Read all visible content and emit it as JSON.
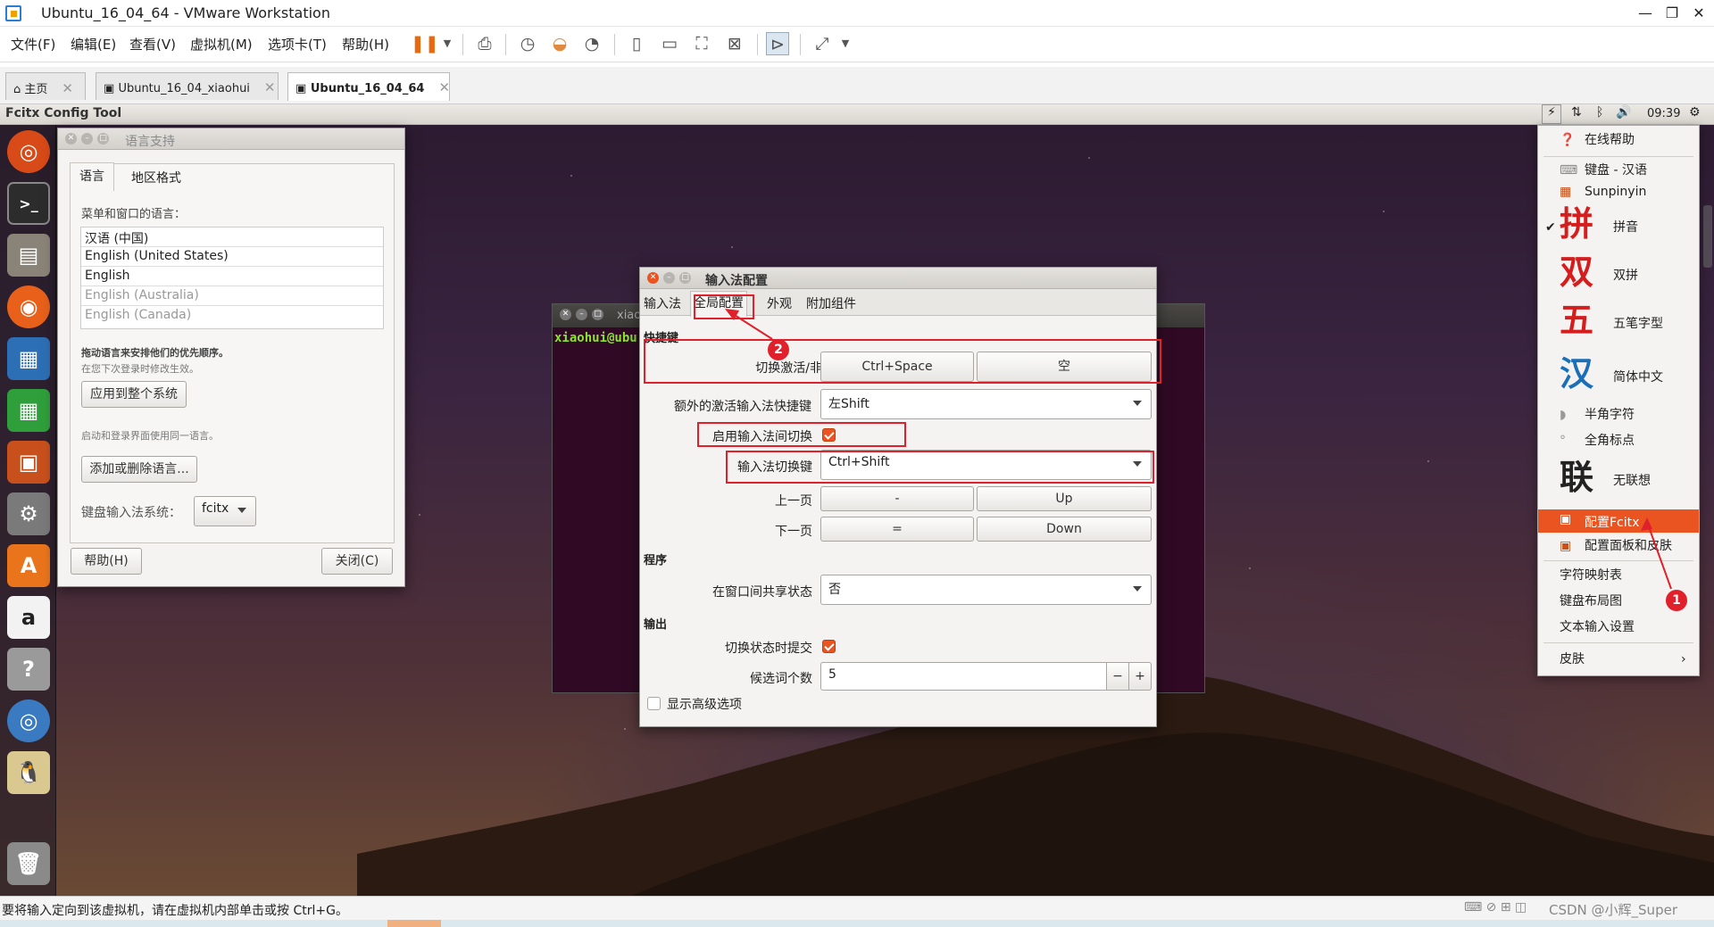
{
  "host": {
    "title": "Ubuntu_16_04_64 - VMware Workstation",
    "menus": [
      "文件(F)",
      "编辑(E)",
      "查看(V)",
      "虚拟机(M)",
      "选项卡(T)",
      "帮助(H)"
    ],
    "tabs": [
      {
        "label": "主页",
        "active": false
      },
      {
        "label": "Ubuntu_16_04_xiaohui",
        "active": false
      },
      {
        "label": "Ubuntu_16_04_64",
        "active": true
      }
    ],
    "status": "要将输入定向到该虚拟机，请在虚拟机内部单击或按 Ctrl+G。",
    "watermark": "CSDN @小辉_Super"
  },
  "ubuntu": {
    "app_title": "Fcitx Config Tool",
    "clock": "09:39"
  },
  "language_window": {
    "title": "语言支持",
    "tabs": [
      "语言",
      "地区格式"
    ],
    "section_label": "菜单和窗口的语言：",
    "languages": [
      "汉语 (中国)",
      "English (United States)",
      "English",
      "English (Australia)",
      "English (Canada)"
    ],
    "hint_bold": "拖动语言来安排他们的优先顺序。",
    "hint_small": "在您下次登录时修改生效。",
    "apply_button": "应用到整个系统",
    "login_hint": "启动和登录界面使用同一语言。",
    "add_remove_button": "添加或删除语言...",
    "im_system_label": "键盘输入法系统：",
    "im_system_value": "fcitx",
    "help_button": "帮助(H)",
    "close_button": "关闭(C)"
  },
  "terminal": {
    "title": "xiao",
    "prompt": "xiaohui@ubu"
  },
  "im_config": {
    "title": "输入法配置",
    "tabs": [
      "输入法",
      "全局配置",
      "外观",
      "附加组件"
    ],
    "active_tab": 1,
    "section_hotkey": "快捷键",
    "toggle_label": "切换激活/非激活输入法",
    "toggle_key1": "Ctrl+Space",
    "toggle_key2": "空",
    "extra_label": "额外的激活输入法快捷键",
    "extra_value": "左Shift",
    "enable_switch_label": "启用输入法间切换",
    "enable_switch_checked": true,
    "switch_key_label": "输入法切换键",
    "switch_key_value": "Ctrl+Shift",
    "prev_label": "上一页",
    "prev_key1": "-",
    "prev_key2": "Up",
    "next_label": "下一页",
    "next_key1": "=",
    "next_key2": "Down",
    "section_program": "程序",
    "share_label": "在窗口间共享状态",
    "share_value": "否",
    "section_output": "输出",
    "commit_label": "切换状态时提交",
    "commit_checked": true,
    "candidates_label": "候选词个数",
    "candidates_value": "5",
    "advanced_label": "显示高级选项",
    "advanced_checked": false
  },
  "annotations": [
    "1",
    "2"
  ],
  "tray_menu": {
    "online_help": "在线帮助",
    "keyboard": "键盘 - 汉语",
    "sunpinyin": "Sunpinyin",
    "pinyin_glyph": "拼",
    "pinyin": "拼音",
    "shuangpin_glyph": "双",
    "shuangpin": "双拼",
    "wubi_glyph": "五",
    "wubi": "五笔字型",
    "simplified_glyph": "汉",
    "simplified": "简体中文",
    "halfwidth": "半角字符",
    "fullwidth_punct": "全角标点",
    "no_assoc_glyph": "联",
    "no_assoc": "无联想",
    "config_fcitx": "配置Fcitx",
    "config_skin": "配置面板和皮肤",
    "charmap": "字符映射表",
    "kbd_layout": "键盘布局图",
    "text_input": "文本输入设置",
    "skin": "皮肤",
    "accent_color": "#e95420"
  }
}
